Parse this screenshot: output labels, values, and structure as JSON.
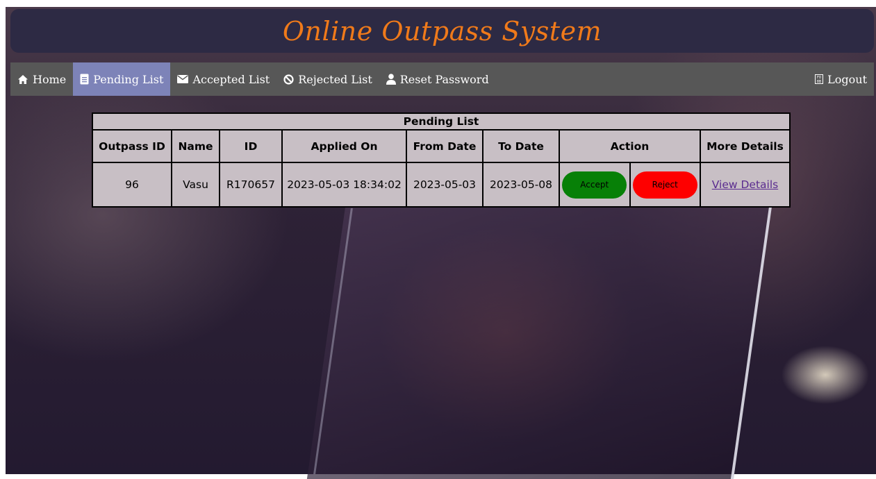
{
  "app": {
    "title": "Online Outpass System"
  },
  "nav": {
    "home": {
      "label": "Home",
      "icon": "home-icon"
    },
    "pending": {
      "label": "Pending List",
      "icon": "document-icon"
    },
    "accepted": {
      "label": "Accepted List",
      "icon": "envelope-icon"
    },
    "rejected": {
      "label": "Rejected List",
      "icon": "ban-icon"
    },
    "reset": {
      "label": "Reset Password",
      "icon": "user-icon"
    },
    "logout": {
      "label": "Logout",
      "icon": "logout-icon"
    }
  },
  "table": {
    "caption": "Pending List",
    "headers": {
      "outpass_id": "Outpass ID",
      "name": "Name",
      "id": "ID",
      "applied_on": "Applied On",
      "from_date": "From Date",
      "to_date": "To Date",
      "action": "Action",
      "more_details": "More Details"
    },
    "rows": [
      {
        "outpass_id": "96",
        "name": "Vasu",
        "id": "R170657",
        "applied_on": "2023-05-03 18:34:02",
        "from_date": "2023-05-03",
        "to_date": "2023-05-08",
        "accept_label": "Accept",
        "reject_label": "Reject",
        "details_label": "View Details"
      }
    ]
  },
  "colors": {
    "title": "#f07a1a",
    "active_nav": "#7d83b8",
    "accept": "#078007",
    "reject": "#fe0000"
  }
}
